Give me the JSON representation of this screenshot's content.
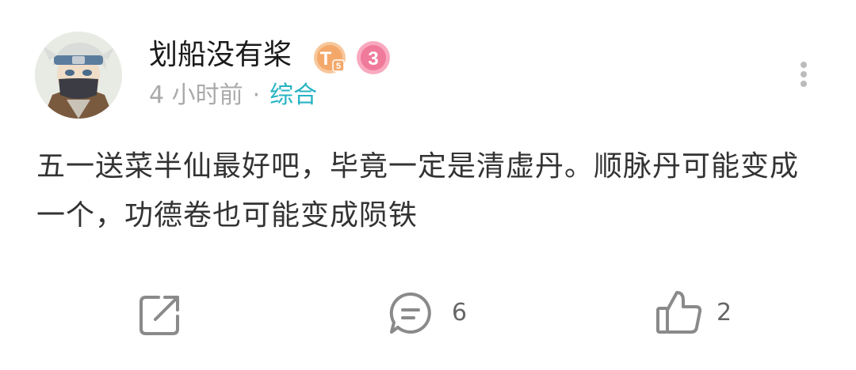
{
  "user": {
    "name": "划船没有桨",
    "badge_t_letter": "T",
    "badge_t_sub": "5",
    "badge_level_glyph": "3",
    "avatar": "avatar-image"
  },
  "meta": {
    "time": "4 小时前",
    "separator": "·",
    "category": "综合"
  },
  "post": {
    "text": "五一送菜半仙最好吧，毕竟一定是清虚丹。顺脉丹可能变成一个，功德卷也可能变成陨铁"
  },
  "actions": {
    "share_icon": "share-icon",
    "comment_icon": "comment-icon",
    "comment_count": "6",
    "like_icon": "thumbs-up-icon",
    "like_count": "2"
  },
  "colors": {
    "category": "#26b3c4",
    "badge_t": "#f3b27a",
    "badge_level": "#f07a9a",
    "icon": "#8a8a8a"
  }
}
